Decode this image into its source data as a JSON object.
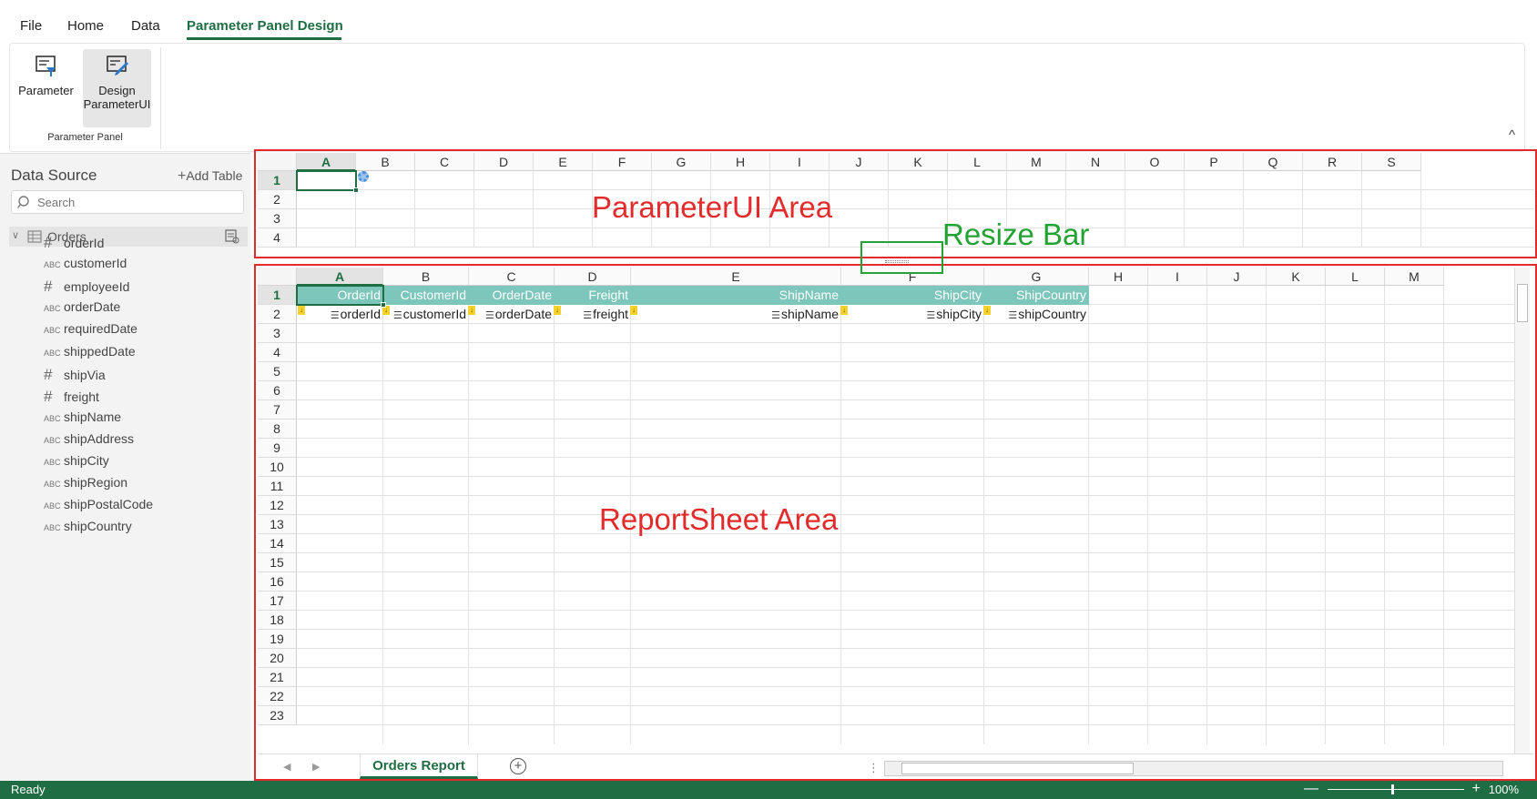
{
  "menu": {
    "tabs": [
      "File",
      "Home",
      "Data",
      "Parameter Panel Design"
    ],
    "active": "Parameter Panel Design"
  },
  "ribbon": {
    "parameter_label": "Parameter",
    "design_label_1": "Design",
    "design_label_2": "ParameterUI",
    "group_label": "Parameter Panel",
    "collapse_glyph": "^"
  },
  "left_panel": {
    "title": "Data Source",
    "add_table": "Add Table",
    "search_placeholder": "Search",
    "table_name": "Orders",
    "fields": [
      {
        "type": "#",
        "name": "orderId"
      },
      {
        "type": "ABC",
        "name": "customerId"
      },
      {
        "type": "#",
        "name": "employeeId"
      },
      {
        "type": "ABC",
        "name": "orderDate"
      },
      {
        "type": "ABC",
        "name": "requiredDate"
      },
      {
        "type": "ABC",
        "name": "shippedDate"
      },
      {
        "type": "#",
        "name": "shipVia"
      },
      {
        "type": "#",
        "name": "freight"
      },
      {
        "type": "ABC",
        "name": "shipName"
      },
      {
        "type": "ABC",
        "name": "shipAddress"
      },
      {
        "type": "ABC",
        "name": "shipCity"
      },
      {
        "type": "ABC",
        "name": "shipRegion"
      },
      {
        "type": "ABC",
        "name": "shipPostalCode"
      },
      {
        "type": "ABC",
        "name": "shipCountry"
      }
    ]
  },
  "param_sheet": {
    "columns": [
      "A",
      "B",
      "C",
      "D",
      "E",
      "F",
      "G",
      "H",
      "I",
      "J",
      "K",
      "L",
      "M",
      "N",
      "O",
      "P",
      "Q",
      "R",
      "S"
    ],
    "rows": [
      "1",
      "2",
      "3",
      "4"
    ]
  },
  "report_sheet": {
    "columns": [
      "A",
      "B",
      "C",
      "D",
      "E",
      "F",
      "G",
      "H",
      "I",
      "J",
      "K",
      "L",
      "M"
    ],
    "rows": [
      "1",
      "2",
      "3",
      "4",
      "5",
      "6",
      "7",
      "8",
      "9",
      "10",
      "11",
      "12",
      "13",
      "14",
      "15",
      "16",
      "17",
      "18",
      "19",
      "20",
      "21",
      "22",
      "23"
    ],
    "header_row": [
      "OrderId",
      "CustomerId",
      "OrderDate",
      "Freight",
      "ShipName",
      "ShipCity",
      "ShipCountry"
    ],
    "binding_row": [
      "orderId",
      "customerId",
      "orderDate",
      "freight",
      "shipName",
      "shipCity",
      "shipCountry"
    ]
  },
  "annotations": {
    "param_area": "ParameterUI Area",
    "resize_bar": "Resize Bar",
    "report_area": "ReportSheet Area"
  },
  "tabbar": {
    "sheet_tab": "Orders Report",
    "add_sheet": "+"
  },
  "status": {
    "ready": "Ready",
    "zoom": "100%"
  },
  "colors": {
    "accent": "#1f6e43",
    "header_band": "#7cc6bb",
    "annotation_red": "#e32b2b",
    "annotation_green": "#22a333"
  }
}
